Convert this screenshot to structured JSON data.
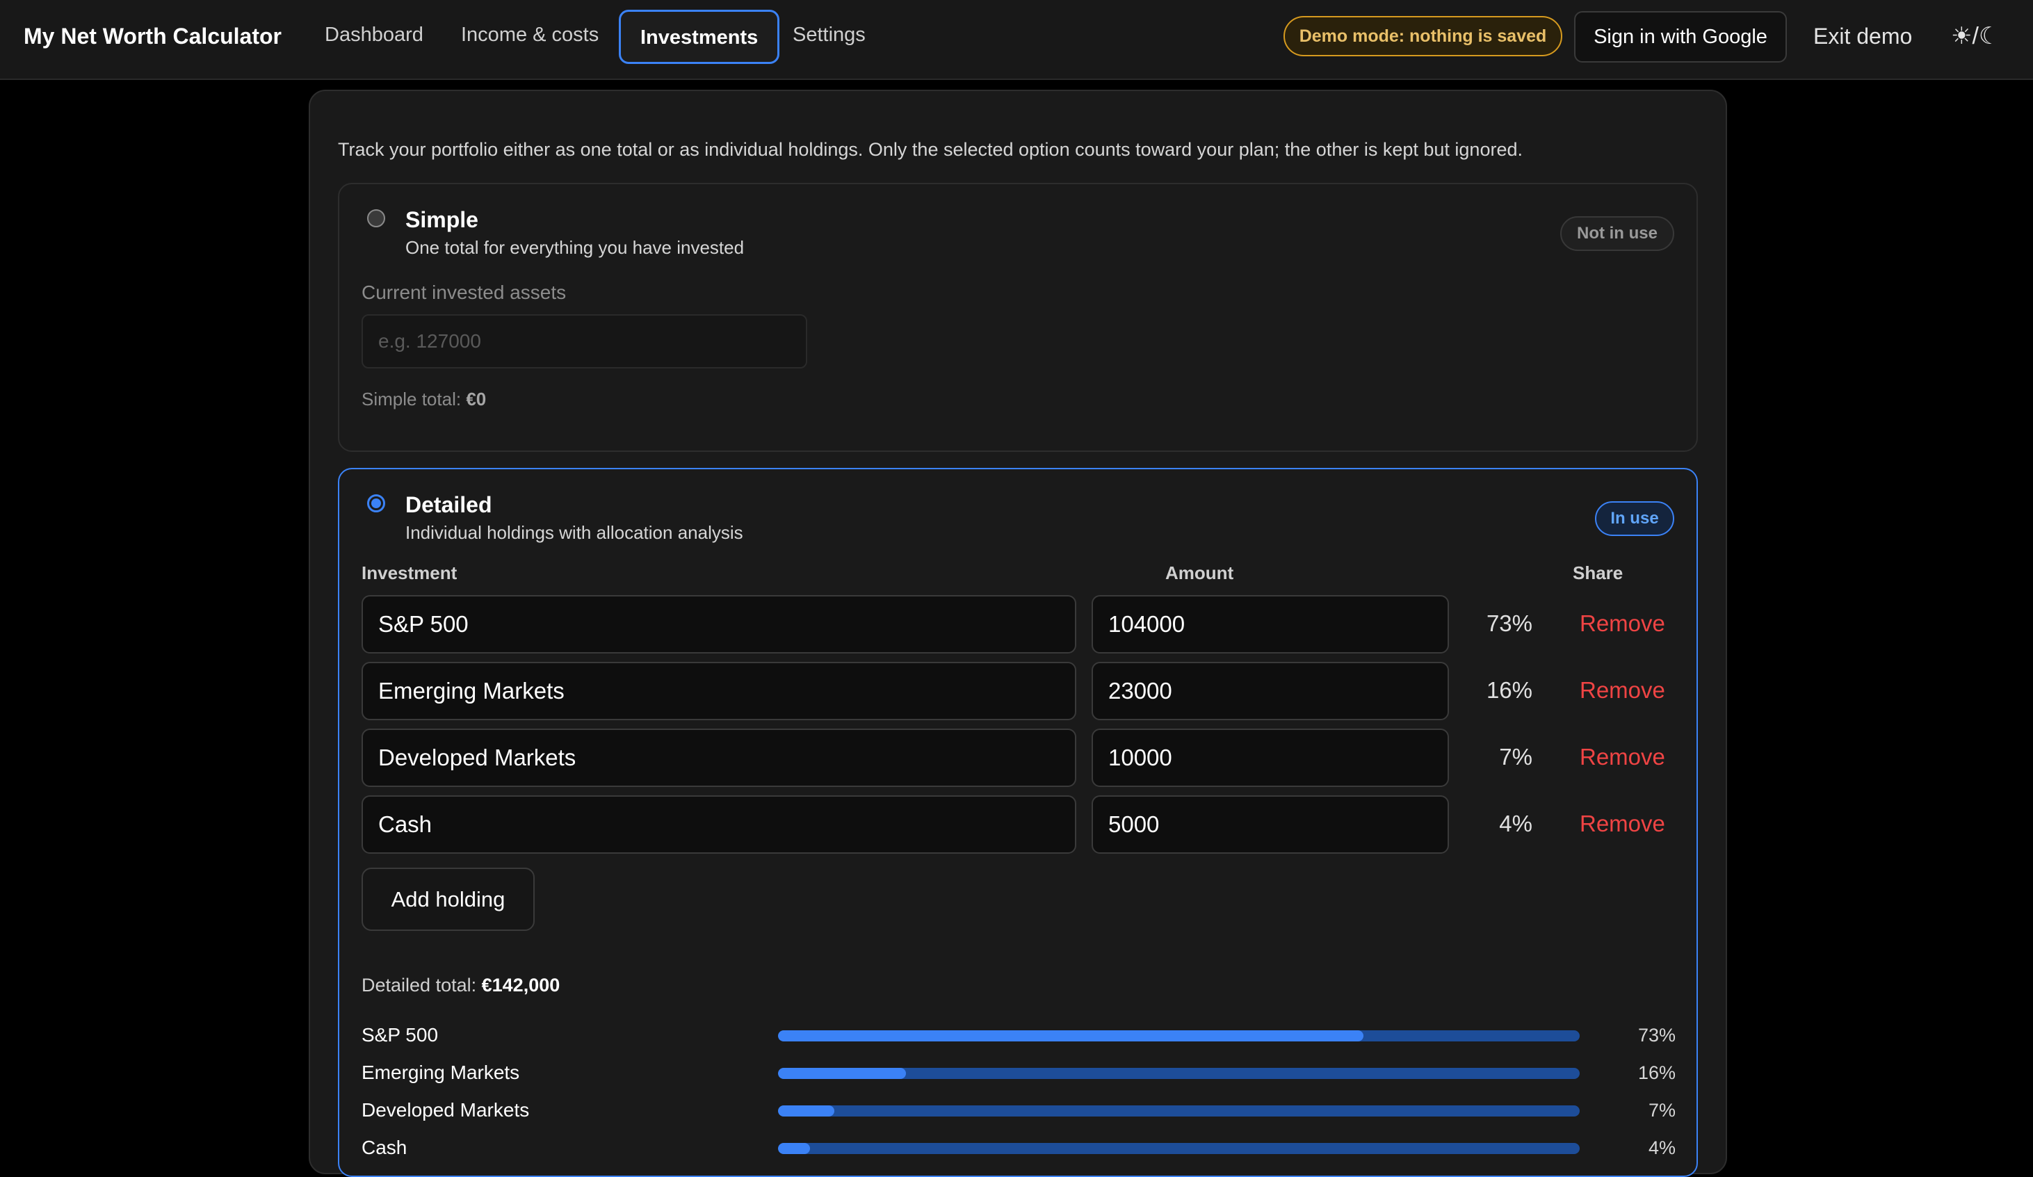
{
  "app": {
    "title": "My Net Worth Calculator"
  },
  "nav": {
    "dashboard": "Dashboard",
    "income_costs": "Income & costs",
    "investments": "Investments",
    "settings": "Settings",
    "active_tab": "Investments"
  },
  "header": {
    "demo_badge": "Demo mode: nothing is saved",
    "sign_in": "Sign in with Google",
    "exit_demo": "Exit demo",
    "theme_toggle": "☀/☾"
  },
  "intro": "Track your portfolio either as one total or as individual holdings. Only the selected option counts toward your plan; the other is kept but ignored.",
  "simple": {
    "title": "Simple",
    "subtitle": "One total for everything you have invested",
    "status": "Not in use",
    "selected": false,
    "field_label": "Current invested assets",
    "input_value": "",
    "input_placeholder": "e.g. 127000",
    "total_label": "Simple total:",
    "total_value": "€0"
  },
  "detailed": {
    "title": "Detailed",
    "subtitle": "Individual holdings with allocation analysis",
    "status": "In use",
    "selected": true,
    "columns": {
      "investment": "Investment",
      "amount": "Amount",
      "share": "Share"
    },
    "holdings": [
      {
        "name": "S&P 500",
        "amount": "104000",
        "share": "73%",
        "share_value": 73,
        "remove_label": "Remove"
      },
      {
        "name": "Emerging Markets",
        "amount": "23000",
        "share": "16%",
        "share_value": 16,
        "remove_label": "Remove"
      },
      {
        "name": "Developed Markets",
        "amount": "10000",
        "share": "7%",
        "share_value": 7,
        "remove_label": "Remove"
      },
      {
        "name": "Cash",
        "amount": "5000",
        "share": "4%",
        "share_value": 4,
        "remove_label": "Remove"
      }
    ],
    "add_button": "Add holding",
    "total_label": "Detailed total:",
    "total_value": "€142,000",
    "allocation": [
      {
        "label": "S&P 500",
        "percent": "73%",
        "value": 73
      },
      {
        "label": "Emerging Markets",
        "percent": "16%",
        "value": 16
      },
      {
        "label": "Developed Markets",
        "percent": "7%",
        "value": 7
      },
      {
        "label": "Cash",
        "percent": "4%",
        "value": 4
      }
    ]
  },
  "colors": {
    "accent": "#3b82f6",
    "danger": "#ef4444",
    "warning": "#d69a1f",
    "background": "#000000",
    "surface": "#1a1a1a"
  },
  "icons": {
    "theme_toggle": "sun-moon-icon",
    "radio_selected": "radio-checked-icon",
    "radio_unselected": "radio-unchecked-icon"
  }
}
